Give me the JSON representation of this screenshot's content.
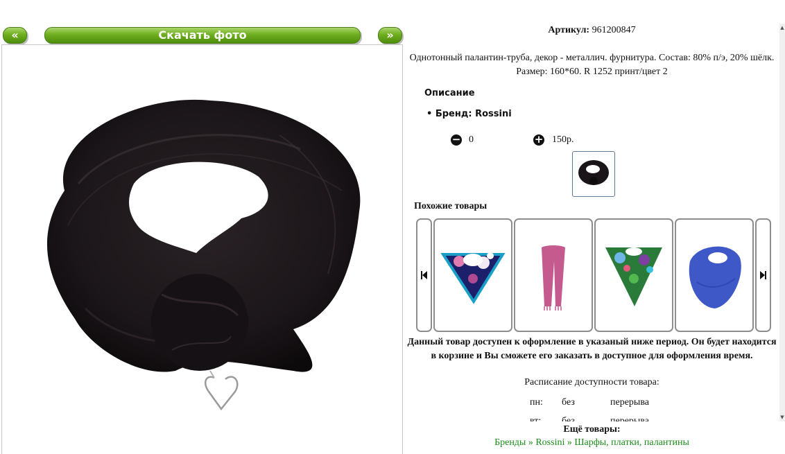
{
  "nav": {
    "prev_label": "«",
    "download_label": "Скачать фото",
    "next_label": "»"
  },
  "product": {
    "article_label": "Артикул:",
    "article_value": "961200847",
    "description": "Однотонный палантин-труба, декор - металлич. фурнитура. Состав: 80% п/э, 20% шёлк. Размер: 160*60. R 1252 принт/цвет 2",
    "description_heading": "Описание",
    "brand_line": "Бренд: Rossini",
    "quantity": "0",
    "price": "150р."
  },
  "similar": {
    "heading": "Похожие товары",
    "items": [
      "floral-silk-scarf",
      "pink-stole",
      "green-floral-scarf",
      "blue-scarf"
    ]
  },
  "availability": {
    "notice": "Данный товар доступен к оформление в указаный ниже период. Он будет находится в корзине и Вы сможете его заказать в доступное для оформления время.",
    "schedule_title": "Расписание доступности товара:",
    "rows": [
      {
        "day": "пн:",
        "from": "без",
        "to": "перерыва"
      },
      {
        "day": "вт:",
        "from": "без",
        "to": "перерыва"
      }
    ]
  },
  "more": {
    "title": "Ещё товары:",
    "links": "Бренды » Rossini » Шарфы, платки, палантины"
  },
  "colors": {
    "accent_green": "#6fae1f",
    "link_green": "#1a8c1a"
  }
}
